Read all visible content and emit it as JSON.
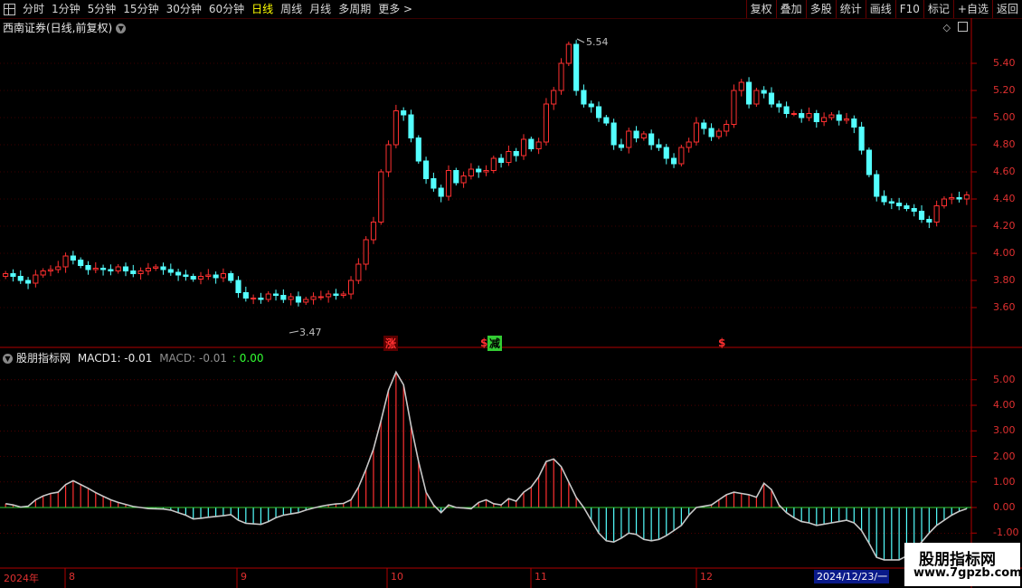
{
  "toolbar": {
    "periods": [
      "分时",
      "1分钟",
      "5分钟",
      "15分钟",
      "30分钟",
      "60分钟",
      "日线",
      "周线",
      "月线",
      "多周期",
      "更多 >"
    ],
    "active_period": "日线",
    "right_buttons": [
      "复权",
      "叠加",
      "多股",
      "统计",
      "画线",
      "F10",
      "标记",
      "+自选",
      "返回"
    ]
  },
  "main_panel": {
    "title": "西南证券(日线,前复权)",
    "high_label": "5.54",
    "low_label": "3.47"
  },
  "indicator_panel": {
    "name": "股朋指标网",
    "macd1_label": "MACD1: -0.01",
    "macd_label": "MACD: -0.01",
    "extra_label": ": 0.00"
  },
  "signals": [
    {
      "text": "涨",
      "color": "#ff2020",
      "bg": "#600000"
    },
    {
      "text": "$",
      "color": "#ff2020"
    },
    {
      "text": "减",
      "color": "#000000",
      "bg": "#33cc33"
    },
    {
      "text": "$",
      "color": "#ff2020"
    }
  ],
  "x_axis": {
    "labels": [
      "2024年",
      "8",
      "9",
      "10",
      "11",
      "12"
    ],
    "date_box": "2024/12/23/一"
  },
  "watermark": {
    "line1": "股朋指标网",
    "line2": "www.7gpzb.com"
  },
  "colors": {
    "up": "#ff3030",
    "down": "#54ffff",
    "grid": "#7a0000",
    "axis": "#b00000",
    "macd_line": "#c8c8c8"
  },
  "chart_data": [
    {
      "type": "candlestick",
      "title": "西南证券(日线,前复权)",
      "y_ticks": [
        5.4,
        5.2,
        5.0,
        4.8,
        4.6,
        4.4,
        4.2,
        4.0,
        3.8,
        3.6
      ],
      "ylim": [
        3.4,
        5.6
      ],
      "close": [
        3.85,
        3.83,
        3.8,
        3.78,
        3.84,
        3.87,
        3.88,
        3.9,
        3.98,
        3.95,
        3.91,
        3.88,
        3.89,
        3.88,
        3.87,
        3.9,
        3.87,
        3.85,
        3.87,
        3.89,
        3.9,
        3.88,
        3.86,
        3.84,
        3.83,
        3.81,
        3.83,
        3.84,
        3.82,
        3.85,
        3.8,
        3.71,
        3.67,
        3.67,
        3.66,
        3.7,
        3.69,
        3.66,
        3.68,
        3.64,
        3.66,
        3.68,
        3.68,
        3.7,
        3.69,
        3.7,
        3.8,
        3.92,
        4.1,
        4.23,
        4.6,
        4.8,
        5.05,
        5.02,
        4.85,
        4.68,
        4.55,
        4.48,
        4.42,
        4.61,
        4.52,
        4.57,
        4.62,
        4.6,
        4.61,
        4.7,
        4.67,
        4.75,
        4.72,
        4.84,
        4.77,
        4.82,
        5.1,
        5.2,
        5.4,
        5.54,
        5.2,
        5.1,
        5.08,
        5.0,
        4.96,
        4.8,
        4.78,
        4.9,
        4.85,
        4.88,
        4.8,
        4.78,
        4.7,
        4.66,
        4.78,
        4.82,
        4.96,
        4.92,
        4.86,
        4.9,
        4.95,
        5.2,
        5.26,
        5.1,
        5.2,
        5.18,
        5.1,
        5.08,
        5.03,
        5.03,
        5.0,
        5.03,
        4.97,
        5.0,
        5.02,
        4.98,
        4.99,
        4.93,
        4.76,
        4.58,
        4.42,
        4.38,
        4.37,
        4.35,
        4.33,
        4.31,
        4.25,
        4.23,
        4.35,
        4.4,
        4.41,
        4.4,
        4.43
      ],
      "macd_hist": [
        0.15,
        0.1,
        0.02,
        0.05,
        0.3,
        0.45,
        0.55,
        0.6,
        0.9,
        1.05,
        0.9,
        0.75,
        0.58,
        0.44,
        0.3,
        0.2,
        0.12,
        0.04,
        0.0,
        -0.04,
        -0.05,
        -0.06,
        -0.1,
        -0.2,
        -0.3,
        -0.45,
        -0.42,
        -0.38,
        -0.35,
        -0.32,
        -0.28,
        -0.5,
        -0.62,
        -0.64,
        -0.66,
        -0.55,
        -0.4,
        -0.3,
        -0.25,
        -0.2,
        -0.1,
        -0.02,
        0.05,
        0.1,
        0.14,
        0.16,
        0.3,
        0.8,
        1.5,
        2.3,
        3.4,
        4.6,
        5.3,
        4.8,
        3.2,
        1.8,
        0.6,
        0.1,
        -0.2,
        0.1,
        0.0,
        -0.02,
        -0.05,
        0.2,
        0.3,
        0.15,
        0.1,
        0.35,
        0.25,
        0.6,
        0.8,
        1.2,
        1.8,
        1.9,
        1.6,
        1.0,
        0.4,
        0.0,
        -0.5,
        -1.0,
        -1.3,
        -1.35,
        -1.2,
        -1.0,
        -1.05,
        -1.25,
        -1.3,
        -1.25,
        -1.1,
        -0.9,
        -0.7,
        -0.3,
        0.0,
        0.05,
        0.1,
        0.3,
        0.5,
        0.6,
        0.55,
        0.5,
        0.4,
        0.95,
        0.7,
        0.1,
        -0.2,
        -0.4,
        -0.55,
        -0.6,
        -0.7,
        -0.65,
        -0.6,
        -0.55,
        -0.5,
        -0.6,
        -0.9,
        -1.4,
        -1.95,
        -2.05,
        -2.05,
        -2.05,
        -1.9,
        -1.7,
        -1.35,
        -1.0,
        -0.7,
        -0.5,
        -0.3,
        -0.15,
        -0.05
      ]
    },
    {
      "type": "bar",
      "title": "MACD",
      "y_ticks": [
        5.0,
        4.0,
        3.0,
        2.0,
        1.0,
        0.0,
        -1.0
      ],
      "ylim": [
        -2.3,
        5.7
      ]
    }
  ]
}
